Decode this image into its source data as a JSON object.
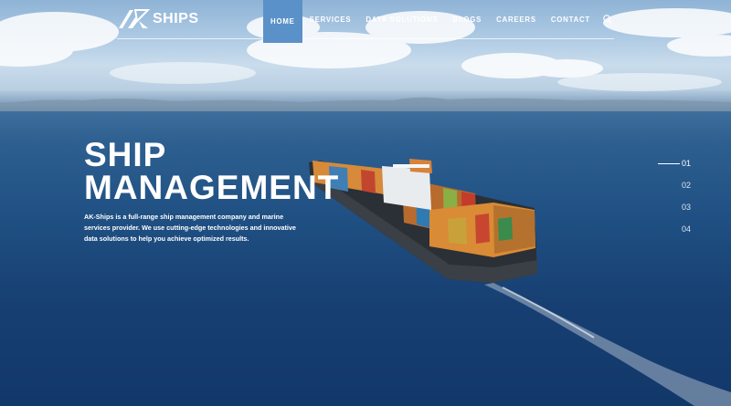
{
  "brand": {
    "name": "SHIPS",
    "logo_mark": "AK"
  },
  "nav": {
    "items": [
      {
        "label": "HOME",
        "active": true
      },
      {
        "label": "SERVICES",
        "active": false
      },
      {
        "label": "DATA SOLUTIONS",
        "active": false
      },
      {
        "label": "BLOGS",
        "active": false
      },
      {
        "label": "CAREERS",
        "active": false
      },
      {
        "label": "CONTACT",
        "active": false
      }
    ],
    "search_icon": "search-icon",
    "active_color": "#5b91c9"
  },
  "hero": {
    "title_line1": "SHIP",
    "title_line2": "MANAGEMENT",
    "description_line1": "AK-Ships is a full-range ship management company and marine",
    "description_line2": "services provider. We use cutting-edge technologies and innovative",
    "description_line3": "data solutions to help you achieve optimized results."
  },
  "slider": {
    "items": [
      {
        "label": "01",
        "active": true
      },
      {
        "label": "02",
        "active": false
      },
      {
        "label": "03",
        "active": false
      },
      {
        "label": "04",
        "active": false
      }
    ]
  }
}
